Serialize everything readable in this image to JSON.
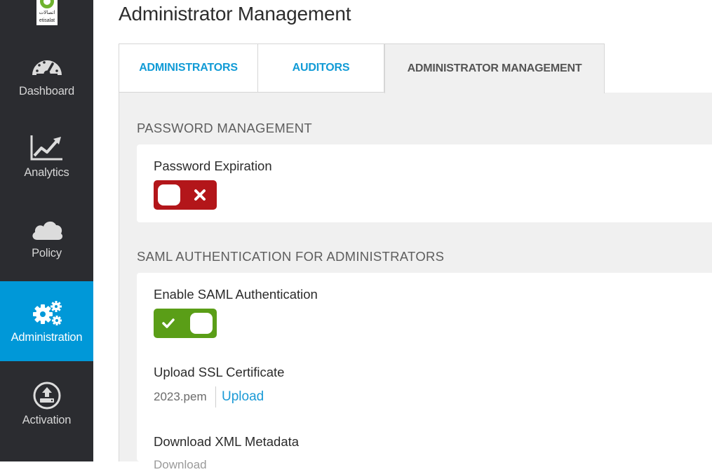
{
  "app": {
    "page_title": "Administrator Management",
    "logo": {
      "arabic": "اتصالات",
      "latin": "etisalat"
    }
  },
  "sidebar": {
    "items": [
      {
        "label": "Dashboard",
        "icon": "dashboard-gauge-icon",
        "active": false
      },
      {
        "label": "Analytics",
        "icon": "analytics-chart-icon",
        "active": false
      },
      {
        "label": "Policy",
        "icon": "cloud-icon",
        "active": false
      },
      {
        "label": "Administration",
        "icon": "gears-icon",
        "active": true
      },
      {
        "label": "Activation",
        "icon": "upload-circle-icon",
        "active": false
      }
    ],
    "colors": {
      "background": "#2b2c30",
      "active": "#0098d8"
    }
  },
  "tabs": [
    {
      "label": "ADMINISTRATORS",
      "active": false
    },
    {
      "label": "AUDITORS",
      "active": false
    },
    {
      "label": "ADMINISTRATOR MANAGEMENT",
      "active": true
    }
  ],
  "sections": {
    "password": {
      "title": "PASSWORD MANAGEMENT",
      "expiration_label": "Password Expiration",
      "expiration_enabled": false
    },
    "saml": {
      "title": "SAML AUTHENTICATION FOR ADMINISTRATORS",
      "enable_label": "Enable SAML Authentication",
      "enabled": true,
      "ssl_label": "Upload SSL Certificate",
      "ssl_file": "2023.pem",
      "upload_label": "Upload",
      "xml_label": "Download XML Metadata",
      "download_label": "Download"
    }
  },
  "colors": {
    "accent": "#119bd6",
    "toggle_off": "#b3161a",
    "toggle_on": "#5a9e17"
  }
}
